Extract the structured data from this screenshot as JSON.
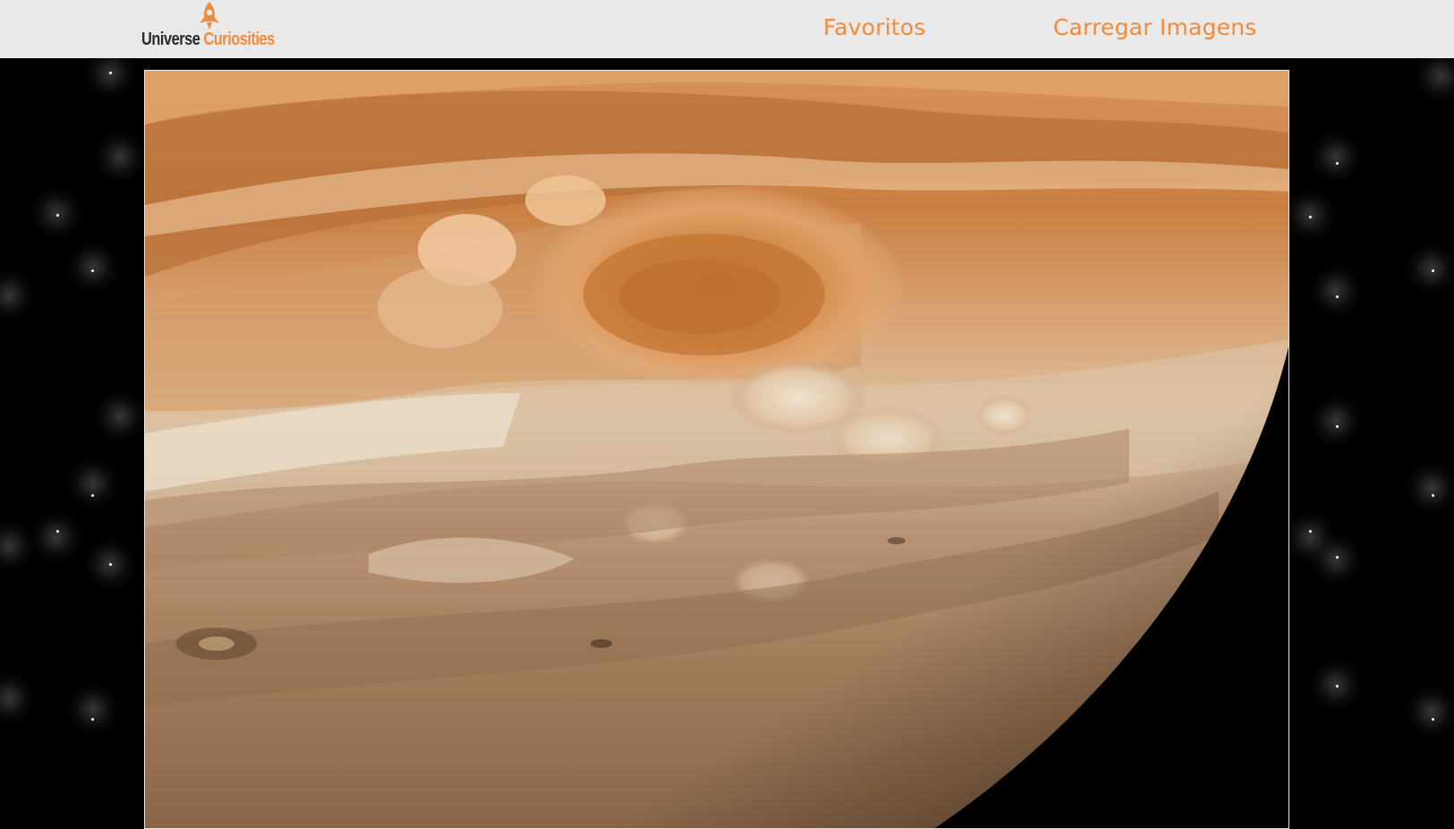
{
  "header": {
    "logo": {
      "word1": "Universe",
      "word2": "Curiosities",
      "icon": "rocket-icon"
    },
    "nav": [
      {
        "label": "Favoritos"
      },
      {
        "label": "Carregar Imagens"
      }
    ]
  },
  "colors": {
    "accent": "#f28a3a",
    "header_bg": "#e9e9e9",
    "background": "#000000"
  },
  "main": {
    "image": {
      "subject": "jupiter-great-red-spot"
    }
  }
}
